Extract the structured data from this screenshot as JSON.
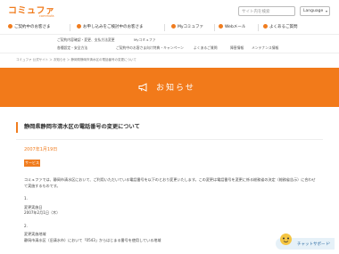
{
  "header": {
    "logo_text": "コミュファ",
    "logo_sub": "commufa",
    "search_placeholder": "サイト内を検索",
    "lang_label": "Language"
  },
  "nav": {
    "items": [
      "ご契約中のお客さま",
      "お申し込みをご検討中のお客さま",
      "Myコミュファ",
      "Webメール",
      "よくあるご質問"
    ]
  },
  "subnav": {
    "items": [
      "ご契約内容確認・変更、支払方法変更",
      "Myコミュファ",
      "各種設定・安全方法",
      "ご契約中のお客さま向け特典・キャンペーン",
      "よくあるご質問",
      "障害情報",
      "メンテナンス情報"
    ]
  },
  "breadcrumb": "コミュファ 公式サイト ＞ お知らせ ＞ 静岡県静岡市清水区の電話番号の変更について",
  "banner": {
    "title": "お知らせ",
    "icon": "megaphone-icon"
  },
  "article": {
    "title": "静岡県静岡市清水区の電話番号の変更について",
    "date": "2007年1月19日",
    "badge": "サービス",
    "paragraph": "コミュファでは、静岡市清水区において、ご利用いただいている電話番号を以下のとおり変更いたします。この変更は電話番号を変更に係る総務省の決定（総務省告示）に合わせて実施するものです。",
    "s1_num": "1.",
    "s1_label": "変更実施日",
    "s1_value": "2007年2月1日（木）",
    "s2_num": "2.",
    "s2_label": "変更実施地域",
    "s2_value": "静岡市清水区（旧清水市）において「0543」からはじまる番号を使用している地域"
  },
  "support": {
    "label": "チャットサポート",
    "icon": "chat-support-icon"
  },
  "colors": {
    "brand_orange": "#f27a1a",
    "support_blue": "#2b6aa3"
  }
}
